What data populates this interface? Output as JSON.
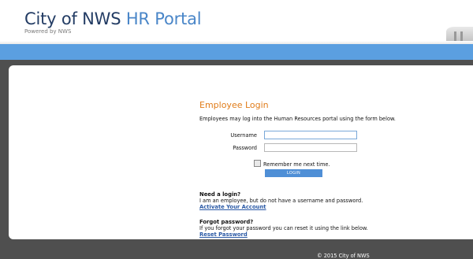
{
  "header": {
    "brand_part1": "City of NWS",
    "brand_part2": "HR Portal",
    "powered_by": "Powered by NWS"
  },
  "login": {
    "title": "Employee Login",
    "description": "Employees may log into the Human Resources portal using the form below.",
    "username_label": "Username",
    "password_label": "Password",
    "username_value": "",
    "password_value": "",
    "remember_label": "Remember me next time.",
    "remember_checked": false,
    "button_label": "LOGIN"
  },
  "need_login": {
    "heading": "Need a login?",
    "text": "I am an employee, but do not have a username and password.",
    "link": "Activate Your Account"
  },
  "forgot_password": {
    "heading": "Forgot password?",
    "text": "If you forgot your password you can reset it using the link below.",
    "link": "Reset Password"
  },
  "footer": {
    "copyright": "© 2015 City of NWS"
  },
  "colors": {
    "brand_dark": "#233c64",
    "brand_light": "#4a86c8",
    "accent_bar": "#5b9fe0",
    "title_orange": "#e07c1a",
    "button_blue": "#4f8fd6",
    "link_blue": "#2b5aa6",
    "page_bg": "#4f4f4f"
  }
}
